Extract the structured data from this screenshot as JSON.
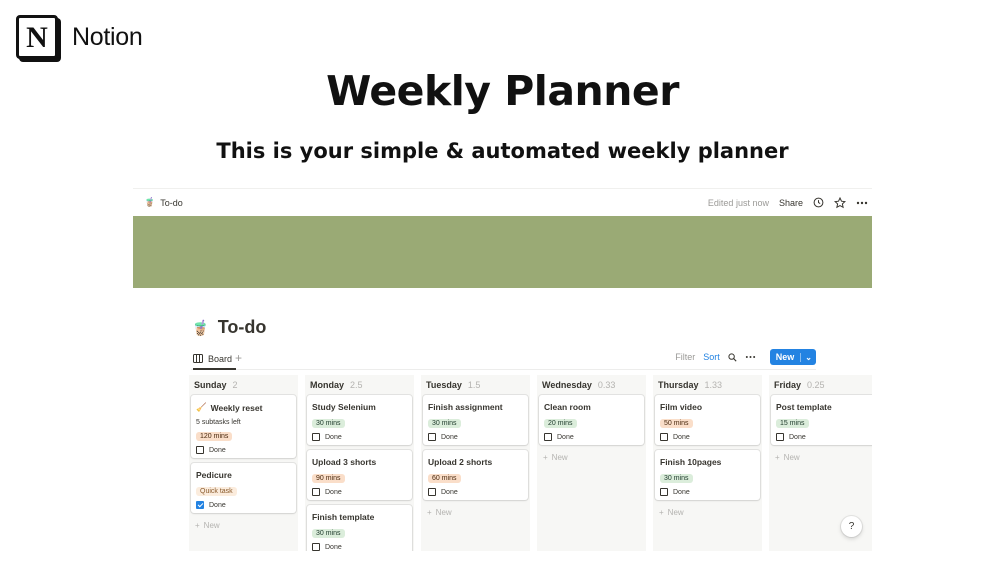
{
  "brand": {
    "logo_letter": "N",
    "name": "Notion"
  },
  "headline": "Weekly Planner",
  "subheadline": "This is your simple & automated weekly planner",
  "topbar": {
    "emoji": "🧋",
    "page_name": "To-do",
    "edited": "Edited just now",
    "share": "Share"
  },
  "cover_color": "#9aaa75",
  "page": {
    "emoji": "🧋",
    "title": "To-do"
  },
  "view": {
    "tab": "Board",
    "add": "+"
  },
  "tools": {
    "filter": "Filter",
    "sort": "Sort",
    "new": "New"
  },
  "columns": [
    {
      "title": "Sunday",
      "count": "2",
      "cards": [
        {
          "icon": "🧹",
          "title": "Weekly reset",
          "sub": "5 subtasks left",
          "tag": "120 mins",
          "tag_color": "orange",
          "done_label": "Done",
          "checked": false
        },
        {
          "title": "Pedicure",
          "tag": "Quick task",
          "tag_color": "quick",
          "done_label": "Done",
          "checked": true
        }
      ],
      "new": "New"
    },
    {
      "title": "Monday",
      "count": "2.5",
      "cards": [
        {
          "title": "Study Selenium",
          "tag": "30 mins",
          "tag_color": "green",
          "done_label": "Done",
          "checked": false
        },
        {
          "title": "Upload 3 shorts",
          "tag": "90 mins",
          "tag_color": "orange",
          "done_label": "Done",
          "checked": false
        },
        {
          "title": "Finish template",
          "tag": "30 mins",
          "tag_color": "green",
          "done_label": "Done",
          "checked": false
        }
      ]
    },
    {
      "title": "Tuesday",
      "count": "1.5",
      "cards": [
        {
          "title": "Finish assignment",
          "tag": "30 mins",
          "tag_color": "green",
          "done_label": "Done",
          "checked": false
        },
        {
          "title": "Upload 2 shorts",
          "tag": "60 mins",
          "tag_color": "orange",
          "done_label": "Done",
          "checked": false
        }
      ],
      "new": "New"
    },
    {
      "title": "Wednesday",
      "count": "0.33",
      "cards": [
        {
          "title": "Clean room",
          "tag": "20 mins",
          "tag_color": "green",
          "done_label": "Done",
          "checked": false
        }
      ],
      "new": "New"
    },
    {
      "title": "Thursday",
      "count": "1.33",
      "cards": [
        {
          "title": "Film video",
          "tag": "50 mins",
          "tag_color": "orange",
          "done_label": "Done",
          "checked": false
        },
        {
          "title": "Finish 10pages",
          "tag": "30 mins",
          "tag_color": "green",
          "done_label": "Done",
          "checked": false
        }
      ],
      "new": "New"
    },
    {
      "title": "Friday",
      "count": "0.25",
      "cards": [
        {
          "title": "Post template",
          "tag": "15 mins",
          "tag_color": "green",
          "done_label": "Done",
          "checked": false
        }
      ],
      "new": "New"
    }
  ],
  "help": "?"
}
